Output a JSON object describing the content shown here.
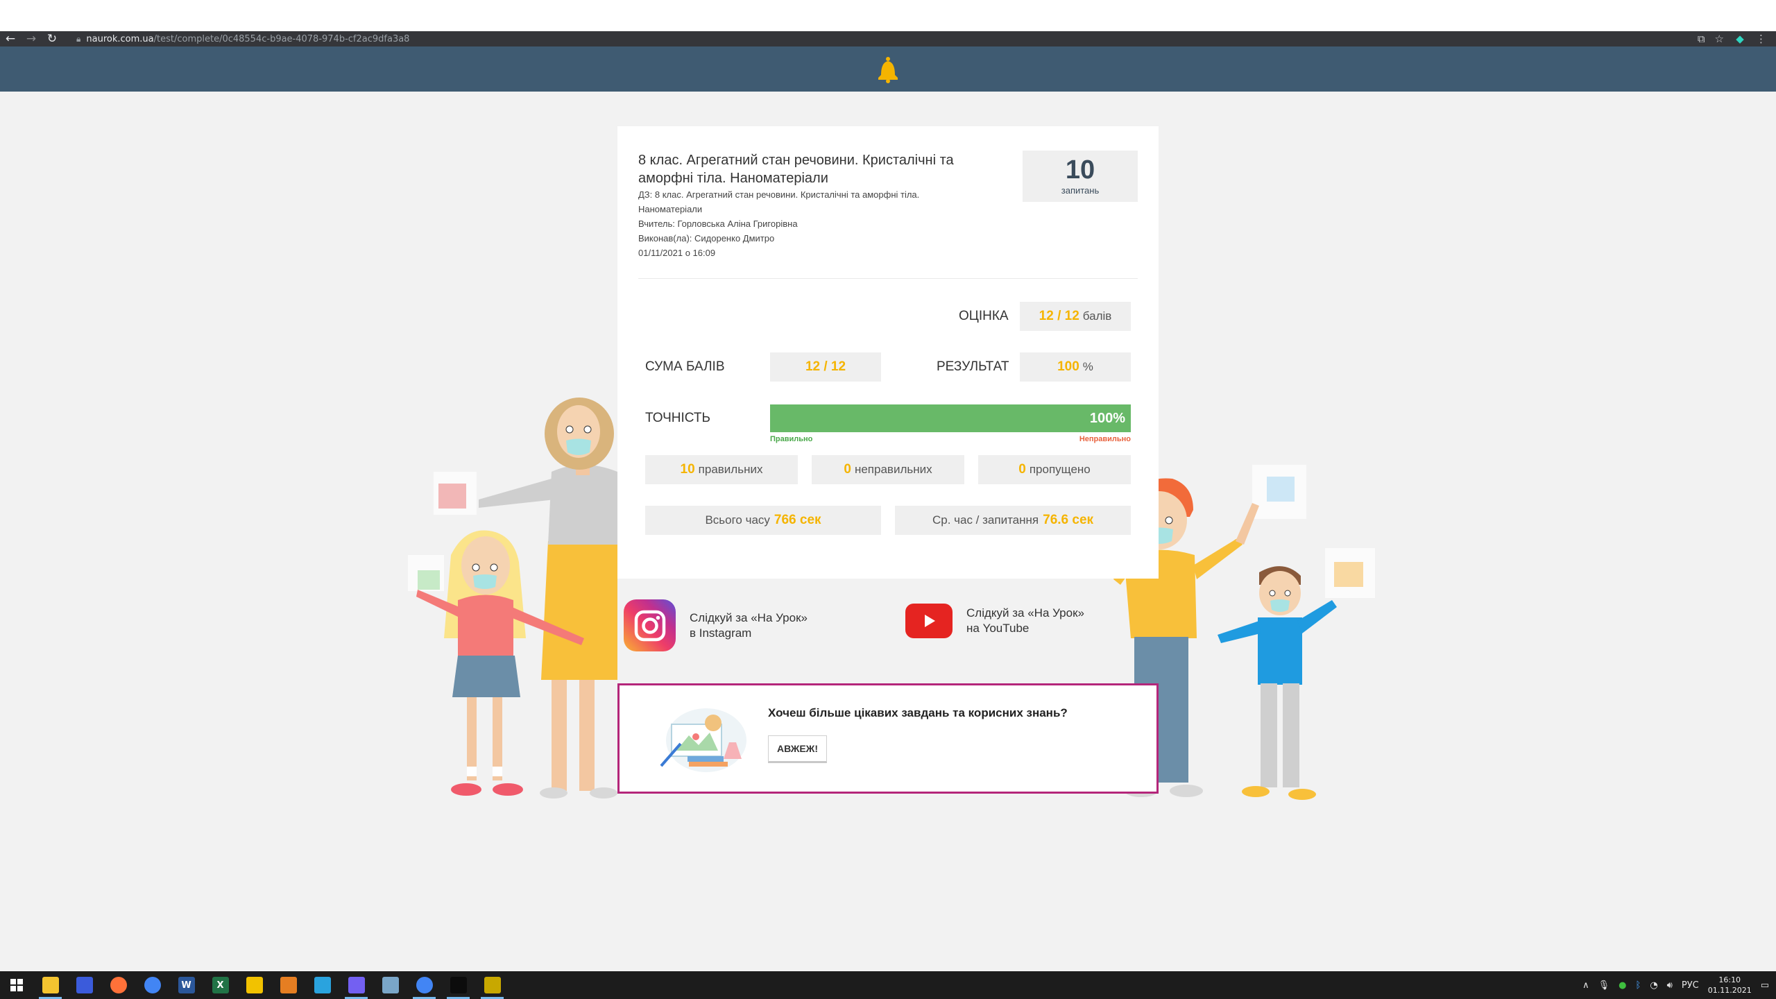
{
  "browser": {
    "url_host": "naurok.com.ua",
    "url_path": "/test/complete/0c48554c-b9ae-4078-974b-cf2ac9dfa3a8"
  },
  "test": {
    "title": "8 клас. Агрегатний стан речовини. Кристалічні та аморфні тіла. Наноматеріали",
    "homework": "ДЗ: 8 клас. Агрегатний стан речовини. Кристалічні та аморфні тіла. Наноматеріали",
    "teacher": "Вчитель: Горловська Аліна Григорівна",
    "student": "Виконав(ла): Сидоренко Дмитро",
    "datetime": "01/11/2021 о 16:09",
    "questions_count": "10",
    "questions_label": "запитань"
  },
  "results": {
    "grade_label": "ОЦІНКА",
    "grade_value": "12 / 12",
    "grade_unit": "балів",
    "sum_label": "СУМА БАЛІВ",
    "sum_value": "12 / 12",
    "result_label": "РЕЗУЛЬТАТ",
    "result_value": "100",
    "result_unit": "%",
    "accuracy_label": "ТОЧНІСТЬ",
    "accuracy_percent": "100%",
    "accuracy_fraction": 1.0,
    "correct_caption": "Правильно",
    "incorrect_caption": "Неправильно",
    "correct_count": "10",
    "correct_label": "правильних",
    "incorrect_count": "0",
    "incorrect_label": "неправильних",
    "skipped_count": "0",
    "skipped_label": "пропущено",
    "total_time_label": "Всього часу",
    "total_time_value": "766 сек",
    "avg_time_label": "Ср. час / запитання",
    "avg_time_value": "76.6 сек"
  },
  "social": {
    "instagram_line1": "Слідкуй за «На Урок»",
    "instagram_line2": "в Instagram",
    "youtube_line1": "Слідкуй за «На Урок»",
    "youtube_line2": "на YouTube"
  },
  "promo": {
    "question": "Хочеш більше цікавих завдань та корисних знань?",
    "button": "АВЖЕЖ!"
  },
  "taskbar": {
    "apps": [
      {
        "name": "file-explorer-icon",
        "color": "#f4c430"
      },
      {
        "name": "save-app-icon",
        "color": "#3b5bdb"
      },
      {
        "name": "firefox-icon",
        "color": "#ff7139"
      },
      {
        "name": "chrome-icon",
        "color": "#4285f4"
      },
      {
        "name": "word-icon",
        "color": "#2b579a",
        "letter": "W"
      },
      {
        "name": "excel-icon",
        "color": "#217346",
        "letter": "X"
      },
      {
        "name": "photos-icon",
        "color": "#f2c200"
      },
      {
        "name": "settings-app-icon",
        "color": "#e67e22"
      },
      {
        "name": "telegram-icon",
        "color": "#2aa3de"
      },
      {
        "name": "viber-icon",
        "color": "#7360f2"
      },
      {
        "name": "notes-app-icon",
        "color": "#7aa6c8"
      },
      {
        "name": "chrome-active-icon",
        "color": "#4285f4"
      },
      {
        "name": "terminal-icon",
        "color": "#0c0c0c"
      },
      {
        "name": "game-app-icon",
        "color": "#c8a800"
      }
    ],
    "language": "РУС",
    "time": "16:10",
    "date": "01.11.2021"
  },
  "colors": {
    "header": "#3f5b72",
    "accent_yellow": "#f5b400",
    "accuracy_green": "#68b968",
    "promo_border": "#b4267a"
  }
}
